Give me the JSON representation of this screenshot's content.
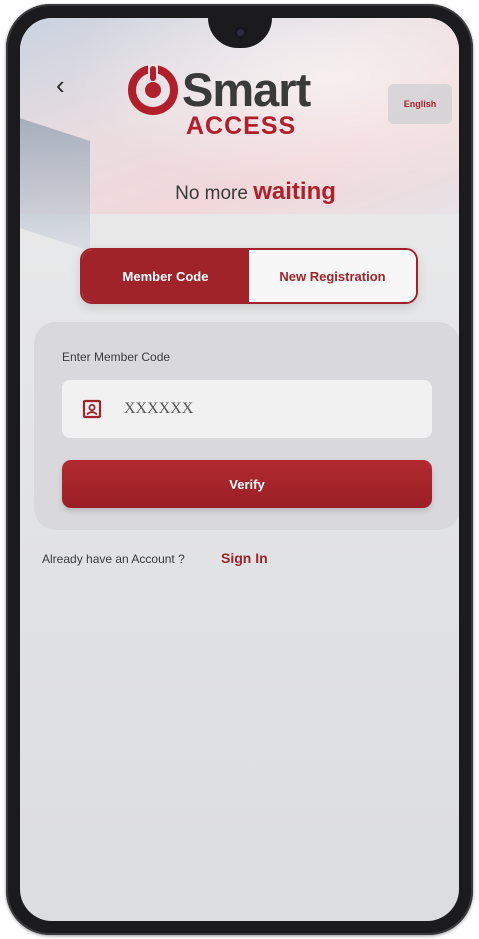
{
  "header": {
    "brand": "Smart",
    "sub_brand": "ACCESS",
    "tagline_prefix": "No more",
    "tagline_emphasis": "waiting",
    "language_label": "English",
    "back_icon": "chevron-left-icon"
  },
  "tabs": [
    {
      "label": "Member Code",
      "active": true
    },
    {
      "label": "New Registration",
      "active": false
    }
  ],
  "form": {
    "label": "Enter Member Code",
    "placeholder": "XXXXXX",
    "value": "",
    "field_icon": "id-card-icon",
    "verify_label": "Verify"
  },
  "footer": {
    "prompt": "Already have an Account ?",
    "link": "Sign In"
  },
  "colors": {
    "accent": "#a1232a",
    "text": "#3a3a3a",
    "card": "#d9d9db"
  }
}
